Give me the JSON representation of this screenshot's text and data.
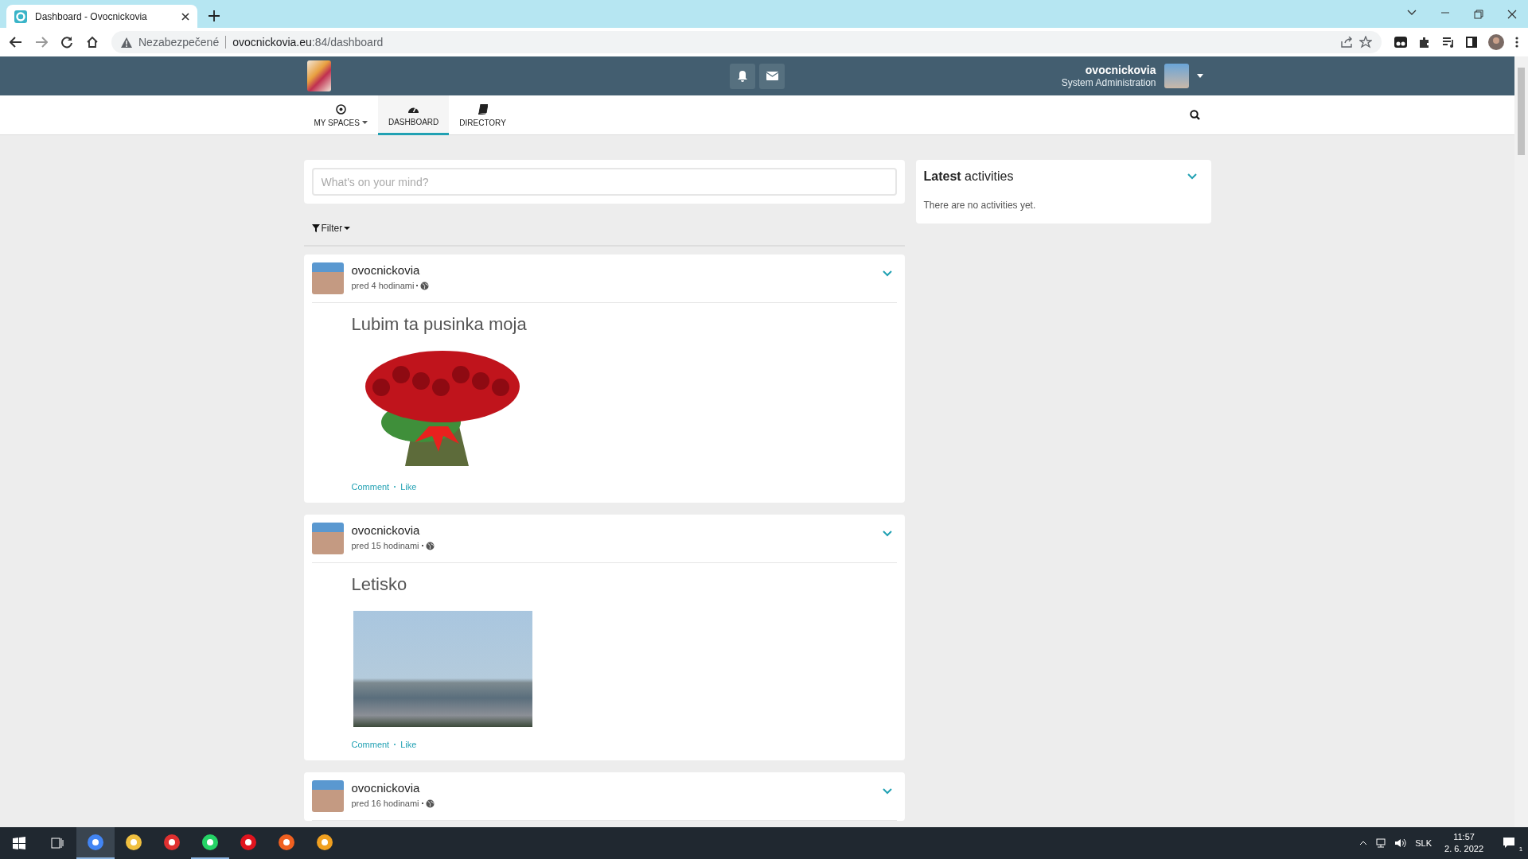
{
  "browser": {
    "tabs": [
      {
        "title": "Dashboard - Ovocnickovia",
        "selected": true
      }
    ],
    "address": {
      "security": "Nezabezpečené",
      "host": "ovocnickovia.eu",
      "path": ":84/dashboard"
    }
  },
  "header": {
    "user_name": "ovocnickovia",
    "user_role": "System Administration"
  },
  "nav": [
    {
      "label": "MY SPACES",
      "kind": "target",
      "dropdown": true,
      "selected": false
    },
    {
      "label": "DASHBOARD",
      "kind": "gauge",
      "dropdown": false,
      "selected": true
    },
    {
      "label": "DIRECTORY",
      "kind": "book",
      "dropdown": false,
      "selected": false
    }
  ],
  "composer": {
    "placeholder": "What's on your mind?"
  },
  "filter": {
    "label": "Filter"
  },
  "posts": [
    {
      "author": "ovocnickovia",
      "time": "pred 4 hodinami",
      "title": "Lubim ta pusinka moja",
      "kind": "flowers",
      "actions": [
        "Comment",
        "Like"
      ]
    },
    {
      "author": "ovocnickovia",
      "time": "pred 15 hodinami",
      "title": "Letisko",
      "kind": "city",
      "actions": [
        "Comment",
        "Like"
      ]
    },
    {
      "author": "ovocnickovia",
      "time": "pred 16 hodinami"
    }
  ],
  "activities": {
    "title": "**Latest** activities",
    "empty_text": "There are no activities yet."
  },
  "taskbar": {
    "apps": [
      {
        "color": "#4285f4",
        "active": true,
        "running": true
      },
      {
        "color": "#f0c040",
        "active": false,
        "running": false
      },
      {
        "color": "#e03030",
        "active": false,
        "running": false
      },
      {
        "color": "#25d366",
        "active": false,
        "running": true
      },
      {
        "color": "#e0141e",
        "active": false,
        "running": false
      },
      {
        "color": "#f06020",
        "active": false,
        "running": false
      },
      {
        "color": "#f0a020",
        "active": false,
        "running": false
      }
    ],
    "language": "SLK",
    "time": "11:57",
    "date": "2. 6. 2022",
    "notification_count": "1"
  }
}
